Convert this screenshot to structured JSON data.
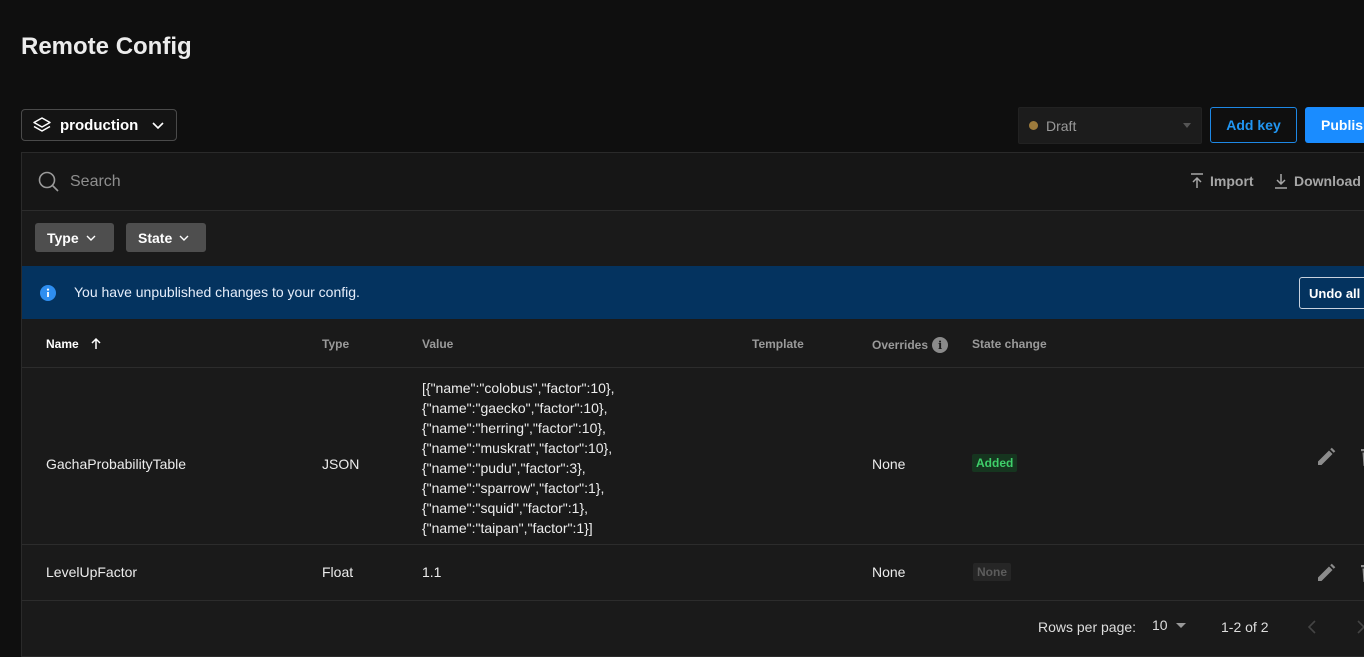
{
  "page": {
    "title": "Remote Config"
  },
  "environment": {
    "label": "production"
  },
  "status_select": {
    "value": "Draft"
  },
  "actions": {
    "add_key": "Add key",
    "publish": "Publish"
  },
  "search": {
    "placeholder": "Search",
    "import_label": "Import",
    "download_label": "Download"
  },
  "filters": {
    "type_label": "Type",
    "state_label": "State"
  },
  "banner": {
    "message": "You have unpublished changes to your config.",
    "undo_label": "Undo all"
  },
  "table": {
    "columns": {
      "name": "Name",
      "type": "Type",
      "value": "Value",
      "template": "Template",
      "overrides": "Overrides",
      "state_change": "State change"
    },
    "rows": [
      {
        "name": "GachaProbabilityTable",
        "type": "JSON",
        "value_lines": [
          "[{\"name\":\"colobus\",\"factor\":10},",
          "{\"name\":\"gaecko\",\"factor\":10},",
          "{\"name\":\"herring\",\"factor\":10},",
          "{\"name\":\"muskrat\",\"factor\":10},",
          "{\"name\":\"pudu\",\"factor\":3},",
          "{\"name\":\"sparrow\",\"factor\":1},",
          "{\"name\":\"squid\",\"factor\":1},",
          "{\"name\":\"taipan\",\"factor\":1}]"
        ],
        "template": "",
        "overrides": "None",
        "state_change": "Added"
      },
      {
        "name": "LevelUpFactor",
        "type": "Float",
        "value_lines": [
          "1.1"
        ],
        "template": "",
        "overrides": "None",
        "state_change": "None"
      }
    ]
  },
  "pagination": {
    "rows_per_page_label": "Rows per page:",
    "rows_per_page": "10",
    "range": "1-2 of 2"
  },
  "colors": {
    "accent": "#1a8cff",
    "banner_bg": "#04335f",
    "added": "#3fcf6a"
  }
}
